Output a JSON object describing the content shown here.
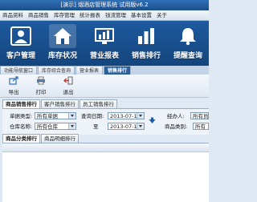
{
  "app": {
    "title": "[演示] 烟酒店管理系统  试用版v6.2"
  },
  "menu": [
    "商品资料",
    "商品销售",
    "库存管理",
    "统计报表",
    "钱流管理",
    "基本设置",
    "关于"
  ],
  "ribbon": [
    {
      "label": "客户管理",
      "icon": "customer-icon"
    },
    {
      "label": "库存状况",
      "icon": "home-icon"
    },
    {
      "label": "营业报表",
      "icon": "report-icon"
    },
    {
      "label": "销售排行",
      "icon": "bar-chart-icon"
    },
    {
      "label": "提醒查询",
      "icon": "bell-icon"
    }
  ],
  "nav_tabs": [
    "功能导航窗口",
    "库存综合查询",
    "营业报表",
    "销售排行"
  ],
  "nav_active": "销售排行",
  "toolbar": {
    "export": "导出",
    "print": "打印",
    "exit": "退出"
  },
  "report_tabs": [
    "商品销售排行",
    "客户销售排行",
    "员工销售排行"
  ],
  "filters": {
    "doc_type_label": "单据类型:",
    "doc_type_value": "所有单据",
    "query_date_label": "查询日期:",
    "date_from": "2013-07-10",
    "handler_label": "经办人:",
    "handler_value": "所有员工",
    "warehouse_label": "仓库名称:",
    "warehouse_value": "所有仓库",
    "to_label": "至",
    "date_to": "2013-07-10",
    "category_label": "商品类别:",
    "category_value": "所有"
  },
  "result_tabs": [
    "商品分类排行",
    "商品明细排行"
  ]
}
